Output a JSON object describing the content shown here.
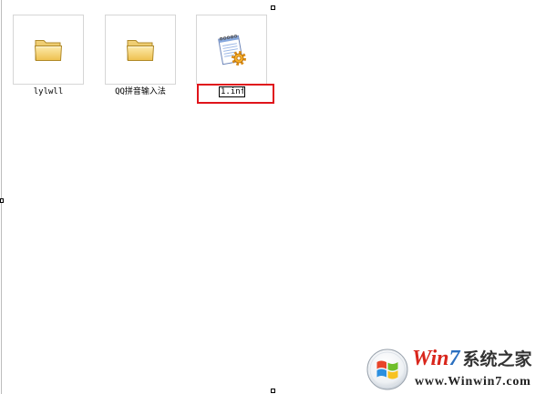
{
  "items": [
    {
      "label": "lylwll",
      "icon": "folder-icon"
    },
    {
      "label": "QQ拼音输入法",
      "icon": "folder-icon"
    },
    {
      "label": "1.inf",
      "icon": "inf-file-icon"
    }
  ],
  "watermark": {
    "brand_prefix": "Win",
    "brand_number": "7",
    "brand_suffix": "系统之家",
    "url": "www.Winwin7.com",
    "icon": "windows-logo-icon"
  },
  "colors": {
    "background": "#ffffff",
    "frame_border": "#d6d6d6",
    "highlight": "#e0141b",
    "brand_red": "#d9261c",
    "brand_blue": "#2a6fc0"
  }
}
